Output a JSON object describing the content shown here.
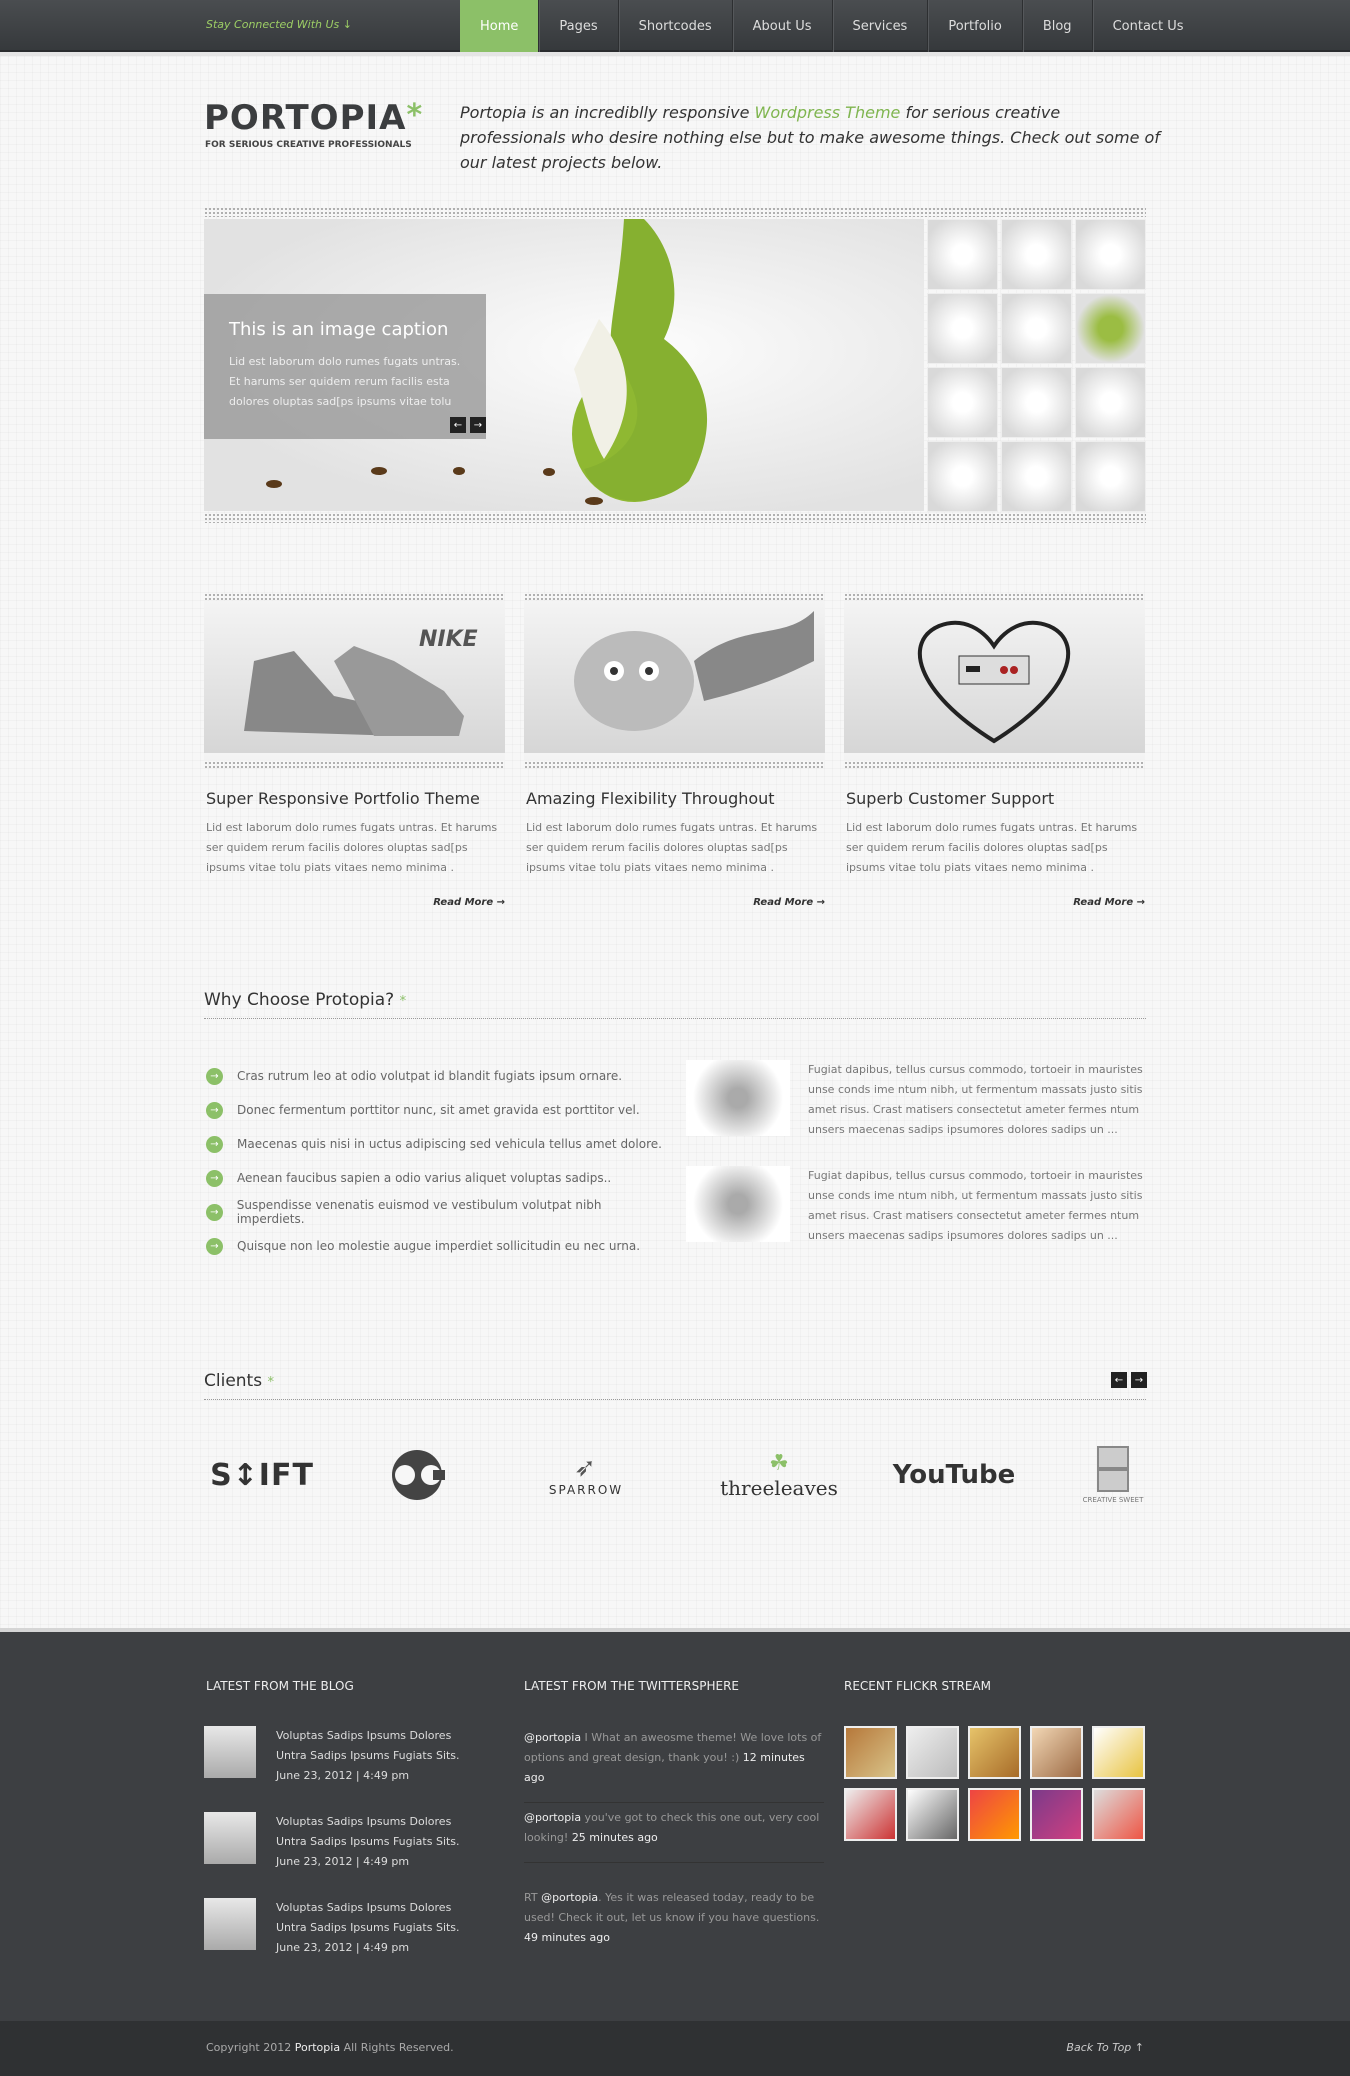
{
  "topbar": {
    "stay": "Stay Connected With Us ↓",
    "nav": [
      "Home",
      "Pages",
      "Shortcodes",
      "About Us",
      "Services",
      "Portfolio",
      "Blog",
      "Contact Us"
    ]
  },
  "header": {
    "logo": "PORTOPIA",
    "logo_mark": "*",
    "tagline": "FOR SERIOUS CREATIVE PROFESSIONALS",
    "intro_a": "Portopia is an incrediblly responsive ",
    "intro_link": "Wordpress Theme",
    "intro_b": " for serious creative professionals who desire nothing else but to make awesome things. Check out some of our latest projects below."
  },
  "slider": {
    "caption_title": "This is an image caption",
    "caption_text": "Lid est laborum dolo rumes fugats untras. Et harums ser quidem rerum facilis esta dolores oluptas sad[ps ipsums vitae tolu",
    "prev": "←",
    "next": "→"
  },
  "features": [
    {
      "title": "Super Responsive Portfolio Theme",
      "text": "Lid est laborum dolo rumes fugats untras. Et harums ser quidem rerum facilis dolores oluptas sad[ps ipsums vitae tolu piats vitaes nemo minima .",
      "more": "Read More →"
    },
    {
      "title": "Amazing Flexibility Throughout",
      "text": "Lid est laborum dolo rumes fugats untras. Et harums ser quidem rerum facilis dolores oluptas sad[ps ipsums vitae tolu piats vitaes nemo minima .",
      "more": "Read More →"
    },
    {
      "title": "Superb Customer Support",
      "text": "Lid est laborum dolo rumes fugats untras. Et harums ser quidem rerum facilis dolores oluptas sad[ps ipsums vitae tolu piats vitaes nemo minima .",
      "more": "Read More →"
    }
  ],
  "why": {
    "title": "Why Choose Protopia?",
    "mark": "*",
    "items": [
      "Cras rutrum leo at odio volutpat id blandit fugiats ipsum ornare.",
      "Donec fermentum porttitor nunc, sit amet gravida est porttitor vel.",
      "Maecenas quis nisi in uctus adipiscing sed vehicula tellus amet dolore.",
      "Aenean faucibus sapien a odio varius aliquet voluptas sadips..",
      "Suspendisse venenatis euismod ve vestibulum volutpat nibh imperdiets.",
      "Quisque non leo molestie augue imperdiet sollicitudin eu nec urna."
    ],
    "blocks": [
      "Fugiat dapibus, tellus cursus commodo, tortoeir in mauristes unse conds ime ntum nibh, ut fermentum massats justo sitis amet risus. Crast matisers consectetut ameter fermes ntum unsers maecenas sadips ipsumores dolores sadips un  ...",
      "Fugiat dapibus, tellus cursus commodo, tortoeir in mauristes unse conds ime ntum nibh, ut fermentum massats justo sitis amet risus. Crast matisers consectetut ameter fermes ntum unsers maecenas sadips ipsumores dolores sadips un  ..."
    ]
  },
  "clients": {
    "title": "Clients",
    "mark": "*",
    "logos": [
      "S↕IFT",
      "OC",
      "SPARROW",
      "threeleaves",
      "YouTube",
      "CREATIVE SWEET"
    ]
  },
  "footer": {
    "blog_title": "LATEST FROM THE BLOG",
    "twitter_title": "LATEST FROM THE TWITTERSPHERE",
    "flickr_title": "RECENT FLICKR STREAM",
    "posts": [
      {
        "title": "Voluptas Sadips Ipsums Dolores Untra Sadips Ipsums Fugiats Sits.",
        "date": "June 23, 2012   |   4:49 pm"
      },
      {
        "title": "Voluptas Sadips Ipsums Dolores Untra Sadips Ipsums Fugiats Sits.",
        "date": "June 23, 2012   |   4:49 pm"
      },
      {
        "title": "Voluptas Sadips Ipsums Dolores Untra Sadips Ipsums Fugiats Sits.",
        "date": "June 23, 2012   |   4:49 pm"
      }
    ],
    "tweets": [
      {
        "user": "@portopia",
        "text": " I What an aweosme theme!  We love lots of options and great design, thank you!  :) ",
        "time": "12 minutes ago"
      },
      {
        "user": "@portopia",
        "text": " you've got to check this one out, very cool looking! ",
        "time": "25 minutes ago"
      },
      {
        "prefix": "RT ",
        "user": "@portopia",
        "text": ". Yes it was released today, ready to be used! Check it out, let us know if you have questions.",
        "time": "49 minutes ago"
      }
    ],
    "copyright_a": "Copyright 2012 ",
    "copyright_brand": "Portopia",
    "copyright_b": "  All Rights Reserved.",
    "back_to_top": "Back To Top ↑"
  }
}
